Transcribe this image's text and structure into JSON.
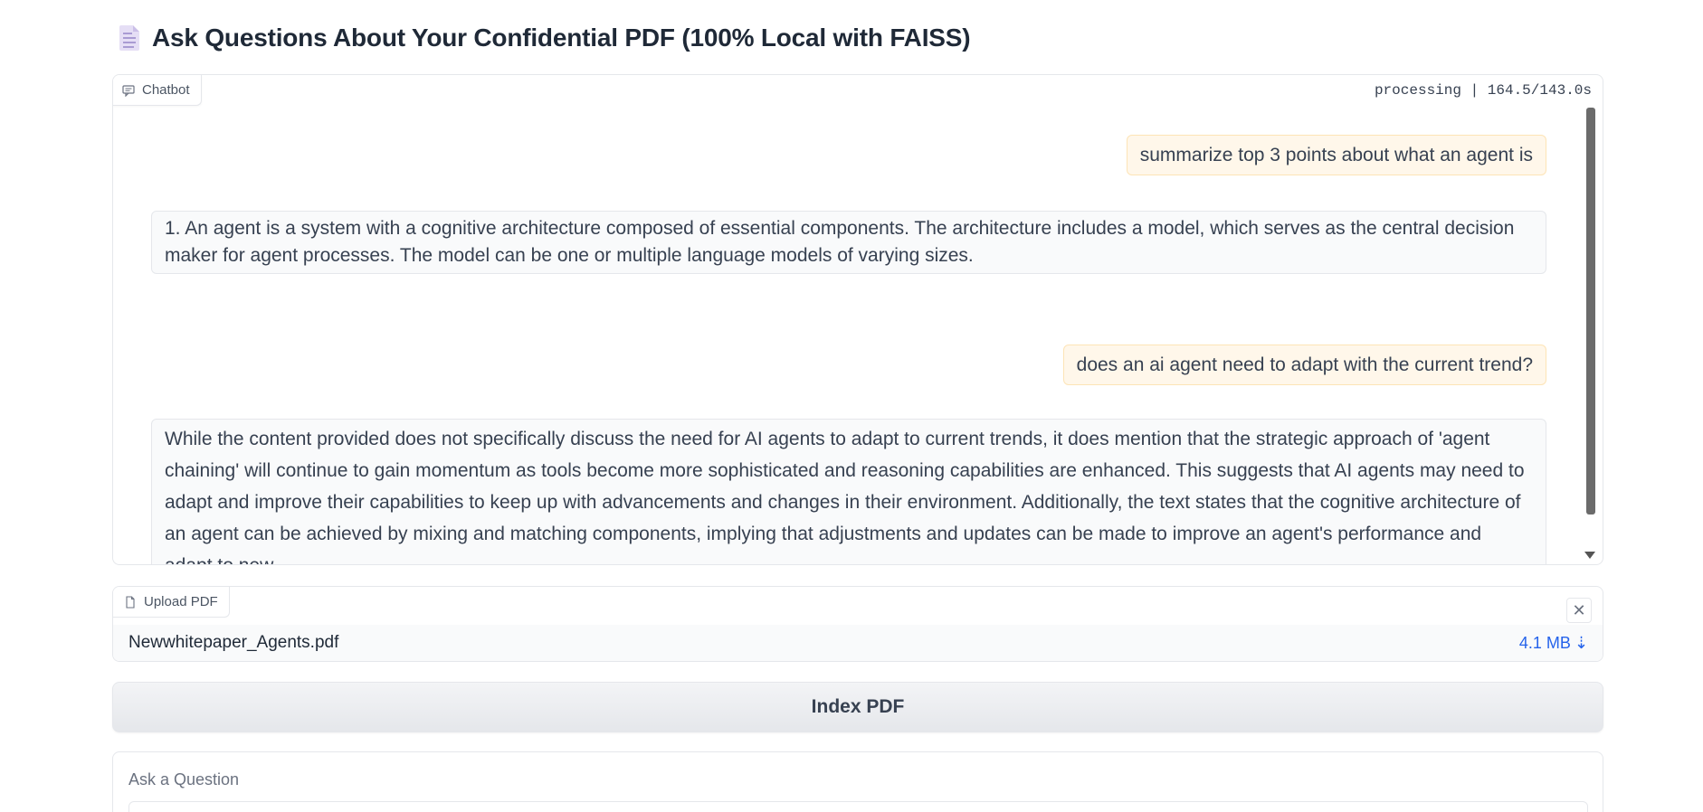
{
  "header": {
    "title": "Ask Questions About Your Confidential PDF (100% Local with FAISS)",
    "icon": "document-icon"
  },
  "chatbot": {
    "label": "Chatbot",
    "icon": "chat-bubble-icon",
    "status": "processing | 164.5/143.0s",
    "messages": [
      {
        "role": "user",
        "text": "summarize top 3 points about what an agent is"
      },
      {
        "role": "assistant",
        "text": "1. An agent is a system with a cognitive architecture composed of essential components. The architecture includes a model, which serves as the central decision maker for agent processes. The model can be one or multiple language models of varying sizes."
      },
      {
        "role": "user",
        "text": "does an ai agent need to adapt with the current trend?"
      },
      {
        "role": "assistant",
        "text": "While the content provided does not specifically discuss the need for AI agents to adapt to current trends, it does mention that the strategic approach of 'agent chaining' will continue to gain momentum as tools become more sophisticated and reasoning capabilities are enhanced. This suggests that AI agents may need to adapt and improve their capabilities to keep up with advancements and changes in their environment. Additionally, the text states that the cognitive architecture of an agent can be achieved by mixing and matching components, implying that adjustments and updates can be made to improve an agent's performance and adapt to new"
      }
    ]
  },
  "upload": {
    "label": "Upload PDF",
    "icon": "file-icon",
    "clear_symbol": "✕",
    "file_name": "Newwhitepaper_Agents.pdf",
    "file_size": "4.1 MB",
    "download_symbol": "⇣"
  },
  "index_button": {
    "label": "Index PDF"
  },
  "question": {
    "label": "Ask a Question",
    "value": "",
    "placeholder": ""
  },
  "colors": {
    "user_bubble": "#fff7ea",
    "bot_bubble": "#f9fafb",
    "link": "#2563eb"
  }
}
